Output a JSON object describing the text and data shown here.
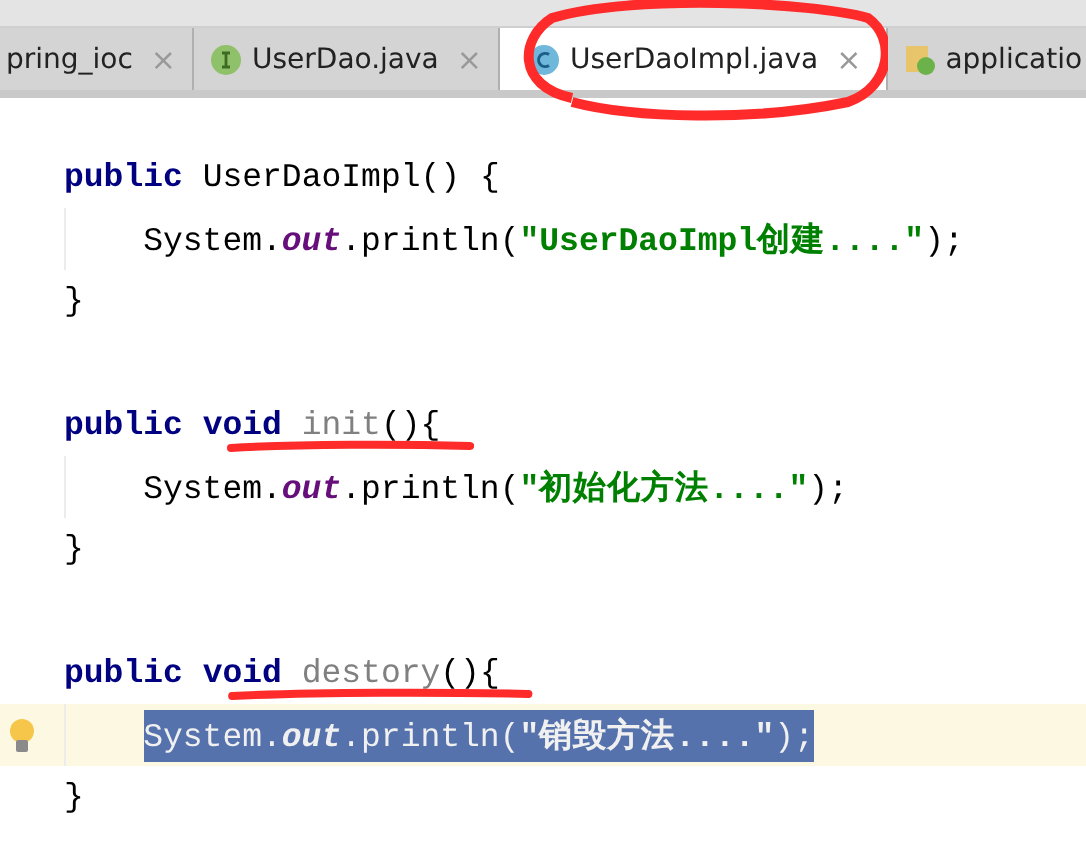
{
  "tabs": [
    {
      "label": "pring_ioc",
      "close": "×",
      "selected": false,
      "circled": false
    },
    {
      "label": "UserDao.java",
      "kind": "interface",
      "close": "×",
      "selected": false,
      "circled": false
    },
    {
      "label": "UserDaoImpl.java",
      "kind": "class",
      "close": "×",
      "selected": true,
      "circled": true
    },
    {
      "label": "applicatio",
      "kind": "xml",
      "selected": false,
      "circled": false
    }
  ],
  "code": [
    {
      "kind": "code",
      "tokens": [
        {
          "text": "public",
          "kind": "keyword"
        },
        {
          "text": " UserDaoImpl() {",
          "kind": "plain"
        }
      ],
      "children": [
        {
          "kind": "code",
          "tokens": [
            {
              "text": "System.",
              "kind": "plain"
            },
            {
              "text": "out",
              "kind": "field"
            },
            {
              "text": ".println(",
              "kind": "plain"
            },
            {
              "text": "\"UserDaoImpl创建....\"",
              "kind": "string"
            },
            {
              "text": ");",
              "kind": "plain"
            }
          ],
          "selected": false,
          "current": false,
          "intention_hint": false
        }
      ]
    },
    {
      "kind": "code",
      "tokens": [
        {
          "text": "}",
          "kind": "plain"
        }
      ]
    },
    {
      "kind": "blank"
    },
    {
      "kind": "code",
      "tokens": [
        {
          "text": "public",
          "kind": "keyword"
        },
        {
          "text": " void",
          "kind": "keyword"
        },
        {
          "text": " init",
          "kind": "unused",
          "underlined": true
        },
        {
          "text": "(){",
          "kind": "plain"
        }
      ],
      "children": [
        {
          "kind": "code",
          "tokens": [
            {
              "text": "System.",
              "kind": "plain"
            },
            {
              "text": "out",
              "kind": "field"
            },
            {
              "text": ".println(",
              "kind": "plain"
            },
            {
              "text": "\"初始化方法....\"",
              "kind": "string"
            },
            {
              "text": ");",
              "kind": "plain"
            }
          ],
          "selected": false,
          "current": false,
          "intention_hint": false
        }
      ]
    },
    {
      "kind": "code",
      "tokens": [
        {
          "text": "}",
          "kind": "plain"
        }
      ]
    },
    {
      "kind": "blank"
    },
    {
      "kind": "code",
      "tokens": [
        {
          "text": "public",
          "kind": "keyword"
        },
        {
          "text": " void",
          "kind": "keyword"
        },
        {
          "text": " destory",
          "kind": "unused",
          "underlined": true
        },
        {
          "text": "(){",
          "kind": "plain"
        }
      ],
      "children": [
        {
          "kind": "code",
          "tokens": [
            {
              "text": "System.",
              "kind": "plain"
            },
            {
              "text": "out",
              "kind": "field"
            },
            {
              "text": ".println(",
              "kind": "plain"
            },
            {
              "text": "\"销毁方法....\"",
              "kind": "string"
            },
            {
              "text": ");",
              "kind": "plain"
            }
          ],
          "selected": true,
          "current": true,
          "intention_hint": true
        }
      ]
    },
    {
      "kind": "code",
      "tokens": [
        {
          "text": "}",
          "kind": "plain"
        }
      ]
    }
  ]
}
